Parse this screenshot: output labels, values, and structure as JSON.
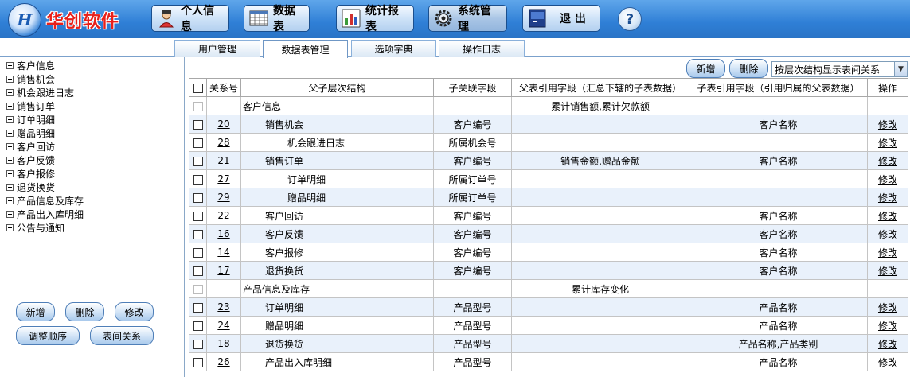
{
  "brand": {
    "logo_text": "H",
    "name": "华创软件"
  },
  "topnav": [
    {
      "label": "个人信息",
      "icon": "user-icon",
      "active": false
    },
    {
      "label": "数据表",
      "icon": "table-icon",
      "active": false
    },
    {
      "label": "统计报表",
      "icon": "chart-icon",
      "active": false
    },
    {
      "label": "系统管理",
      "icon": "gear-icon",
      "active": true
    },
    {
      "label": "退 出",
      "icon": "exit-icon",
      "active": false
    }
  ],
  "help_label": "?",
  "tabs": [
    {
      "label": "用户管理",
      "active": false
    },
    {
      "label": "数据表管理",
      "active": true
    },
    {
      "label": "选项字典",
      "active": false
    },
    {
      "label": "操作日志",
      "active": false
    }
  ],
  "tree": [
    "客户信息",
    "销售机会",
    "机会跟进日志",
    "销售订单",
    "订单明细",
    "赠品明细",
    "客户回访",
    "客户反馈",
    "客户报修",
    "退货换货",
    "产品信息及库存",
    "产品出入库明细",
    "公告与通知"
  ],
  "left_buttons": {
    "add": "新增",
    "delete": "删除",
    "edit": "修改",
    "reorder": "调整顺序",
    "relations": "表间关系"
  },
  "toolbar": {
    "add": "新增",
    "delete": "删除",
    "view_select": "按层次结构显示表间关系"
  },
  "columns": [
    "关系号",
    "父子层次结构",
    "子关联字段",
    "父表引用字段（汇总下辖的子表数据）",
    "子表引用字段（引用归属的父表数据）",
    "操作"
  ],
  "edit_label": "修改",
  "rows": [
    {
      "id": "",
      "name": "客户信息",
      "indent": 0,
      "child_field": "",
      "parent_ref": "累计销售额,累计欠款额",
      "child_ref": "",
      "group": true
    },
    {
      "id": "20",
      "name": "销售机会",
      "indent": 1,
      "child_field": "客户编号",
      "parent_ref": "",
      "child_ref": "客户名称",
      "group": false
    },
    {
      "id": "28",
      "name": "机会跟进日志",
      "indent": 2,
      "child_field": "所属机会号",
      "parent_ref": "",
      "child_ref": "",
      "group": false
    },
    {
      "id": "21",
      "name": "销售订单",
      "indent": 1,
      "child_field": "客户编号",
      "parent_ref": "销售金额,赠品金额",
      "child_ref": "客户名称",
      "group": false
    },
    {
      "id": "27",
      "name": "订单明细",
      "indent": 2,
      "child_field": "所属订单号",
      "parent_ref": "",
      "child_ref": "",
      "group": false
    },
    {
      "id": "29",
      "name": "赠品明细",
      "indent": 2,
      "child_field": "所属订单号",
      "parent_ref": "",
      "child_ref": "",
      "group": false
    },
    {
      "id": "22",
      "name": "客户回访",
      "indent": 1,
      "child_field": "客户编号",
      "parent_ref": "",
      "child_ref": "客户名称",
      "group": false
    },
    {
      "id": "16",
      "name": "客户反馈",
      "indent": 1,
      "child_field": "客户编号",
      "parent_ref": "",
      "child_ref": "客户名称",
      "group": false
    },
    {
      "id": "14",
      "name": "客户报修",
      "indent": 1,
      "child_field": "客户编号",
      "parent_ref": "",
      "child_ref": "客户名称",
      "group": false
    },
    {
      "id": "17",
      "name": "退货换货",
      "indent": 1,
      "child_field": "客户编号",
      "parent_ref": "",
      "child_ref": "客户名称",
      "group": false
    },
    {
      "id": "",
      "name": "产品信息及库存",
      "indent": 0,
      "child_field": "",
      "parent_ref": "累计库存变化",
      "child_ref": "",
      "group": true
    },
    {
      "id": "23",
      "name": "订单明细",
      "indent": 1,
      "child_field": "产品型号",
      "parent_ref": "",
      "child_ref": "产品名称",
      "group": false
    },
    {
      "id": "24",
      "name": "赠品明细",
      "indent": 1,
      "child_field": "产品型号",
      "parent_ref": "",
      "child_ref": "产品名称",
      "group": false
    },
    {
      "id": "18",
      "name": "退货换货",
      "indent": 1,
      "child_field": "产品型号",
      "parent_ref": "",
      "child_ref": "产品名称,产品类别",
      "group": false
    },
    {
      "id": "26",
      "name": "产品出入库明细",
      "indent": 1,
      "child_field": "产品型号",
      "parent_ref": "",
      "child_ref": "产品名称",
      "group": false
    }
  ]
}
